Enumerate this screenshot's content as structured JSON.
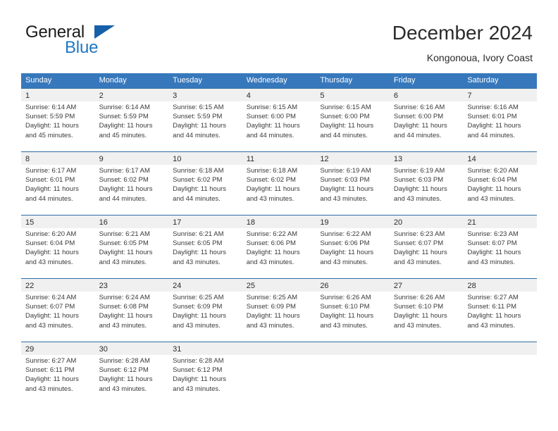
{
  "brand": {
    "name_part1": "General",
    "name_part2": "Blue",
    "triangle_color": "#1560a8",
    "blue_color": "#1f77c2"
  },
  "header": {
    "title": "December 2024",
    "subtitle": "Kongonoua, Ivory Coast"
  },
  "theme": {
    "header_row_bg": "#3778bc",
    "week_separator": "#2e6da4",
    "daynum_band_bg": "#f0f0f0",
    "text_color": "#3a3a3a"
  },
  "weekdays": [
    "Sunday",
    "Monday",
    "Tuesday",
    "Wednesday",
    "Thursday",
    "Friday",
    "Saturday"
  ],
  "weeks": [
    [
      {
        "day": "1",
        "sunrise": "Sunrise: 6:14 AM",
        "sunset": "Sunset: 5:59 PM",
        "daylight1": "Daylight: 11 hours",
        "daylight2": "and 45 minutes."
      },
      {
        "day": "2",
        "sunrise": "Sunrise: 6:14 AM",
        "sunset": "Sunset: 5:59 PM",
        "daylight1": "Daylight: 11 hours",
        "daylight2": "and 45 minutes."
      },
      {
        "day": "3",
        "sunrise": "Sunrise: 6:15 AM",
        "sunset": "Sunset: 5:59 PM",
        "daylight1": "Daylight: 11 hours",
        "daylight2": "and 44 minutes."
      },
      {
        "day": "4",
        "sunrise": "Sunrise: 6:15 AM",
        "sunset": "Sunset: 6:00 PM",
        "daylight1": "Daylight: 11 hours",
        "daylight2": "and 44 minutes."
      },
      {
        "day": "5",
        "sunrise": "Sunrise: 6:15 AM",
        "sunset": "Sunset: 6:00 PM",
        "daylight1": "Daylight: 11 hours",
        "daylight2": "and 44 minutes."
      },
      {
        "day": "6",
        "sunrise": "Sunrise: 6:16 AM",
        "sunset": "Sunset: 6:00 PM",
        "daylight1": "Daylight: 11 hours",
        "daylight2": "and 44 minutes."
      },
      {
        "day": "7",
        "sunrise": "Sunrise: 6:16 AM",
        "sunset": "Sunset: 6:01 PM",
        "daylight1": "Daylight: 11 hours",
        "daylight2": "and 44 minutes."
      }
    ],
    [
      {
        "day": "8",
        "sunrise": "Sunrise: 6:17 AM",
        "sunset": "Sunset: 6:01 PM",
        "daylight1": "Daylight: 11 hours",
        "daylight2": "and 44 minutes."
      },
      {
        "day": "9",
        "sunrise": "Sunrise: 6:17 AM",
        "sunset": "Sunset: 6:02 PM",
        "daylight1": "Daylight: 11 hours",
        "daylight2": "and 44 minutes."
      },
      {
        "day": "10",
        "sunrise": "Sunrise: 6:18 AM",
        "sunset": "Sunset: 6:02 PM",
        "daylight1": "Daylight: 11 hours",
        "daylight2": "and 44 minutes."
      },
      {
        "day": "11",
        "sunrise": "Sunrise: 6:18 AM",
        "sunset": "Sunset: 6:02 PM",
        "daylight1": "Daylight: 11 hours",
        "daylight2": "and 43 minutes."
      },
      {
        "day": "12",
        "sunrise": "Sunrise: 6:19 AM",
        "sunset": "Sunset: 6:03 PM",
        "daylight1": "Daylight: 11 hours",
        "daylight2": "and 43 minutes."
      },
      {
        "day": "13",
        "sunrise": "Sunrise: 6:19 AM",
        "sunset": "Sunset: 6:03 PM",
        "daylight1": "Daylight: 11 hours",
        "daylight2": "and 43 minutes."
      },
      {
        "day": "14",
        "sunrise": "Sunrise: 6:20 AM",
        "sunset": "Sunset: 6:04 PM",
        "daylight1": "Daylight: 11 hours",
        "daylight2": "and 43 minutes."
      }
    ],
    [
      {
        "day": "15",
        "sunrise": "Sunrise: 6:20 AM",
        "sunset": "Sunset: 6:04 PM",
        "daylight1": "Daylight: 11 hours",
        "daylight2": "and 43 minutes."
      },
      {
        "day": "16",
        "sunrise": "Sunrise: 6:21 AM",
        "sunset": "Sunset: 6:05 PM",
        "daylight1": "Daylight: 11 hours",
        "daylight2": "and 43 minutes."
      },
      {
        "day": "17",
        "sunrise": "Sunrise: 6:21 AM",
        "sunset": "Sunset: 6:05 PM",
        "daylight1": "Daylight: 11 hours",
        "daylight2": "and 43 minutes."
      },
      {
        "day": "18",
        "sunrise": "Sunrise: 6:22 AM",
        "sunset": "Sunset: 6:06 PM",
        "daylight1": "Daylight: 11 hours",
        "daylight2": "and 43 minutes."
      },
      {
        "day": "19",
        "sunrise": "Sunrise: 6:22 AM",
        "sunset": "Sunset: 6:06 PM",
        "daylight1": "Daylight: 11 hours",
        "daylight2": "and 43 minutes."
      },
      {
        "day": "20",
        "sunrise": "Sunrise: 6:23 AM",
        "sunset": "Sunset: 6:07 PM",
        "daylight1": "Daylight: 11 hours",
        "daylight2": "and 43 minutes."
      },
      {
        "day": "21",
        "sunrise": "Sunrise: 6:23 AM",
        "sunset": "Sunset: 6:07 PM",
        "daylight1": "Daylight: 11 hours",
        "daylight2": "and 43 minutes."
      }
    ],
    [
      {
        "day": "22",
        "sunrise": "Sunrise: 6:24 AM",
        "sunset": "Sunset: 6:07 PM",
        "daylight1": "Daylight: 11 hours",
        "daylight2": "and 43 minutes."
      },
      {
        "day": "23",
        "sunrise": "Sunrise: 6:24 AM",
        "sunset": "Sunset: 6:08 PM",
        "daylight1": "Daylight: 11 hours",
        "daylight2": "and 43 minutes."
      },
      {
        "day": "24",
        "sunrise": "Sunrise: 6:25 AM",
        "sunset": "Sunset: 6:09 PM",
        "daylight1": "Daylight: 11 hours",
        "daylight2": "and 43 minutes."
      },
      {
        "day": "25",
        "sunrise": "Sunrise: 6:25 AM",
        "sunset": "Sunset: 6:09 PM",
        "daylight1": "Daylight: 11 hours",
        "daylight2": "and 43 minutes."
      },
      {
        "day": "26",
        "sunrise": "Sunrise: 6:26 AM",
        "sunset": "Sunset: 6:10 PM",
        "daylight1": "Daylight: 11 hours",
        "daylight2": "and 43 minutes."
      },
      {
        "day": "27",
        "sunrise": "Sunrise: 6:26 AM",
        "sunset": "Sunset: 6:10 PM",
        "daylight1": "Daylight: 11 hours",
        "daylight2": "and 43 minutes."
      },
      {
        "day": "28",
        "sunrise": "Sunrise: 6:27 AM",
        "sunset": "Sunset: 6:11 PM",
        "daylight1": "Daylight: 11 hours",
        "daylight2": "and 43 minutes."
      }
    ],
    [
      {
        "day": "29",
        "sunrise": "Sunrise: 6:27 AM",
        "sunset": "Sunset: 6:11 PM",
        "daylight1": "Daylight: 11 hours",
        "daylight2": "and 43 minutes."
      },
      {
        "day": "30",
        "sunrise": "Sunrise: 6:28 AM",
        "sunset": "Sunset: 6:12 PM",
        "daylight1": "Daylight: 11 hours",
        "daylight2": "and 43 minutes."
      },
      {
        "day": "31",
        "sunrise": "Sunrise: 6:28 AM",
        "sunset": "Sunset: 6:12 PM",
        "daylight1": "Daylight: 11 hours",
        "daylight2": "and 43 minutes."
      },
      {
        "day": "",
        "sunrise": "",
        "sunset": "",
        "daylight1": "",
        "daylight2": ""
      },
      {
        "day": "",
        "sunrise": "",
        "sunset": "",
        "daylight1": "",
        "daylight2": ""
      },
      {
        "day": "",
        "sunrise": "",
        "sunset": "",
        "daylight1": "",
        "daylight2": ""
      },
      {
        "day": "",
        "sunrise": "",
        "sunset": "",
        "daylight1": "",
        "daylight2": ""
      }
    ]
  ]
}
